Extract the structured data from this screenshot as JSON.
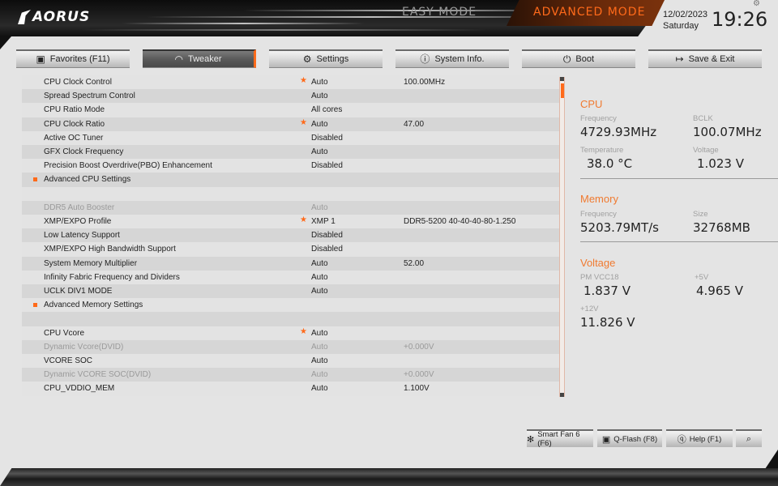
{
  "header": {
    "brand": "AORUS",
    "modes": {
      "easy": "EASY MODE",
      "advanced": "ADVANCED MODE"
    },
    "date": "12/02/2023",
    "day": "Saturday",
    "time": "19:26"
  },
  "tabs": [
    {
      "label": "Favorites (F11)",
      "icon": "favorites-icon",
      "glyph": "▣",
      "active": false
    },
    {
      "label": "Tweaker",
      "icon": "speedometer-icon",
      "glyph": "◠",
      "active": true
    },
    {
      "label": "Settings",
      "icon": "gear-icon",
      "glyph": "⚙",
      "active": false
    },
    {
      "label": "System Info.",
      "icon": "info-icon",
      "glyph": "ⓘ",
      "active": false
    },
    {
      "label": "Boot",
      "icon": "power-icon",
      "glyph": "⏻",
      "active": false
    },
    {
      "label": "Save & Exit",
      "icon": "exit-icon",
      "glyph": "↦",
      "active": false
    }
  ],
  "settings": [
    {
      "label": "CPU Clock Control",
      "value": "Auto",
      "extra": "100.00MHz",
      "star": true,
      "dim": false,
      "submenu": false
    },
    {
      "label": "Spread Spectrum Control",
      "value": "Auto",
      "extra": "",
      "star": false,
      "dim": false,
      "submenu": false
    },
    {
      "label": "CPU Ratio Mode",
      "value": "All cores",
      "extra": "",
      "star": false,
      "dim": false,
      "submenu": false
    },
    {
      "label": "CPU Clock Ratio",
      "value": "Auto",
      "extra": "47.00",
      "star": true,
      "dim": false,
      "submenu": false
    },
    {
      "label": "Active OC Tuner",
      "value": "Disabled",
      "extra": "",
      "star": false,
      "dim": false,
      "submenu": false
    },
    {
      "label": "GFX Clock Frequency",
      "value": "Auto",
      "extra": "",
      "star": false,
      "dim": false,
      "submenu": false
    },
    {
      "label": "Precision Boost Overdrive(PBO) Enhancement",
      "value": "Disabled",
      "extra": "",
      "star": false,
      "dim": false,
      "submenu": false
    },
    {
      "label": "Advanced CPU Settings",
      "value": "",
      "extra": "",
      "star": false,
      "dim": false,
      "submenu": true
    },
    {
      "label": "",
      "value": "",
      "extra": "",
      "star": false,
      "dim": false,
      "submenu": false
    },
    {
      "label": "DDR5 Auto Booster",
      "value": "Auto",
      "extra": "",
      "star": false,
      "dim": true,
      "submenu": false
    },
    {
      "label": "XMP/EXPO Profile",
      "value": "XMP 1",
      "extra": "DDR5-5200 40-40-40-80-1.250",
      "star": true,
      "dim": false,
      "submenu": false
    },
    {
      "label": "Low Latency Support",
      "value": "Disabled",
      "extra": "",
      "star": false,
      "dim": false,
      "submenu": false
    },
    {
      "label": "XMP/EXPO High Bandwidth Support",
      "value": "Disabled",
      "extra": "",
      "star": false,
      "dim": false,
      "submenu": false
    },
    {
      "label": "System Memory Multiplier",
      "value": "Auto",
      "extra": "52.00",
      "star": false,
      "dim": false,
      "submenu": false
    },
    {
      "label": "Infinity Fabric Frequency and Dividers",
      "value": "Auto",
      "extra": "",
      "star": false,
      "dim": false,
      "submenu": false
    },
    {
      "label": "UCLK DIV1 MODE",
      "value": "Auto",
      "extra": "",
      "star": false,
      "dim": false,
      "submenu": false
    },
    {
      "label": "Advanced Memory Settings",
      "value": "",
      "extra": "",
      "star": false,
      "dim": false,
      "submenu": true
    },
    {
      "label": "",
      "value": "",
      "extra": "",
      "star": false,
      "dim": false,
      "submenu": false
    },
    {
      "label": "CPU Vcore",
      "value": "Auto",
      "extra": "",
      "star": true,
      "dim": false,
      "submenu": false
    },
    {
      "label": "Dynamic Vcore(DVID)",
      "value": "Auto",
      "extra": "+0.000V",
      "star": false,
      "dim": true,
      "submenu": false
    },
    {
      "label": "VCORE SOC",
      "value": "Auto",
      "extra": "",
      "star": false,
      "dim": false,
      "submenu": false
    },
    {
      "label": "Dynamic VCORE SOC(DVID)",
      "value": "Auto",
      "extra": "+0.000V",
      "star": false,
      "dim": true,
      "submenu": false
    },
    {
      "label": "CPU_VDDIO_MEM",
      "value": "Auto",
      "extra": "1.100V",
      "star": false,
      "dim": false,
      "submenu": false
    }
  ],
  "monitor": {
    "cpu": {
      "title": "CPU",
      "frequency_label": "Frequency",
      "frequency": "4729.93MHz",
      "bclk_label": "BCLK",
      "bclk": "100.07MHz",
      "temperature_label": "Temperature",
      "temperature": "38.0 °C",
      "voltage_label": "Voltage",
      "voltage": "1.023 V"
    },
    "memory": {
      "title": "Memory",
      "frequency_label": "Frequency",
      "frequency": "5203.79MT/s",
      "size_label": "Size",
      "size": "32768MB"
    },
    "voltage": {
      "title": "Voltage",
      "pmvcc18_label": "PM VCC18",
      "pmvcc18": "1.837 V",
      "v5_label": "+5V",
      "v5": "4.965 V",
      "v12_label": "+12V",
      "v12": "11.826 V"
    }
  },
  "bottom_buttons": [
    {
      "label": "Smart Fan 6 (F6)",
      "icon": "fan-icon",
      "glyph": "✻"
    },
    {
      "label": "Q-Flash (F8)",
      "icon": "qflash-icon",
      "glyph": "▣"
    },
    {
      "label": "Help (F1)",
      "icon": "help-icon",
      "glyph": "ⓠ"
    },
    {
      "label": "",
      "icon": "search-icon",
      "glyph": "⌕"
    }
  ],
  "colors": {
    "accent": "#ff6a1a",
    "section_title": "#f07a30"
  }
}
